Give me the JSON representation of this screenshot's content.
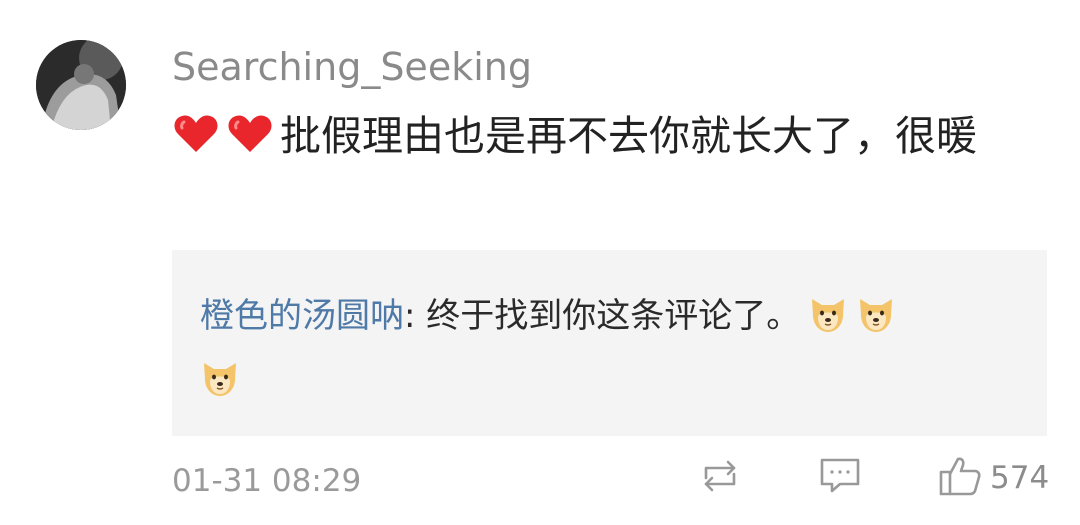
{
  "comment": {
    "username": "Searching_Seeking",
    "text": "批假理由也是再不去你就长大了，很暖",
    "leading_emoji": [
      "heart",
      "heart"
    ],
    "timestamp": "01-31 08:29",
    "like_count": "574"
  },
  "reply": {
    "author": "橙色的汤圆呐",
    "separator": ": ",
    "text": "终于找到你这条评论了。",
    "trailing_emoji": [
      "doge",
      "doge",
      "doge"
    ]
  },
  "actions": {
    "repost_icon": "repost-icon",
    "reply_icon": "comment-icon",
    "like_icon": "thumbs-up-icon"
  },
  "colors": {
    "username": "#8a8a8a",
    "reply_author": "#4f7aa8",
    "reply_background": "#f4f4f4",
    "heart": "#e8262c"
  }
}
